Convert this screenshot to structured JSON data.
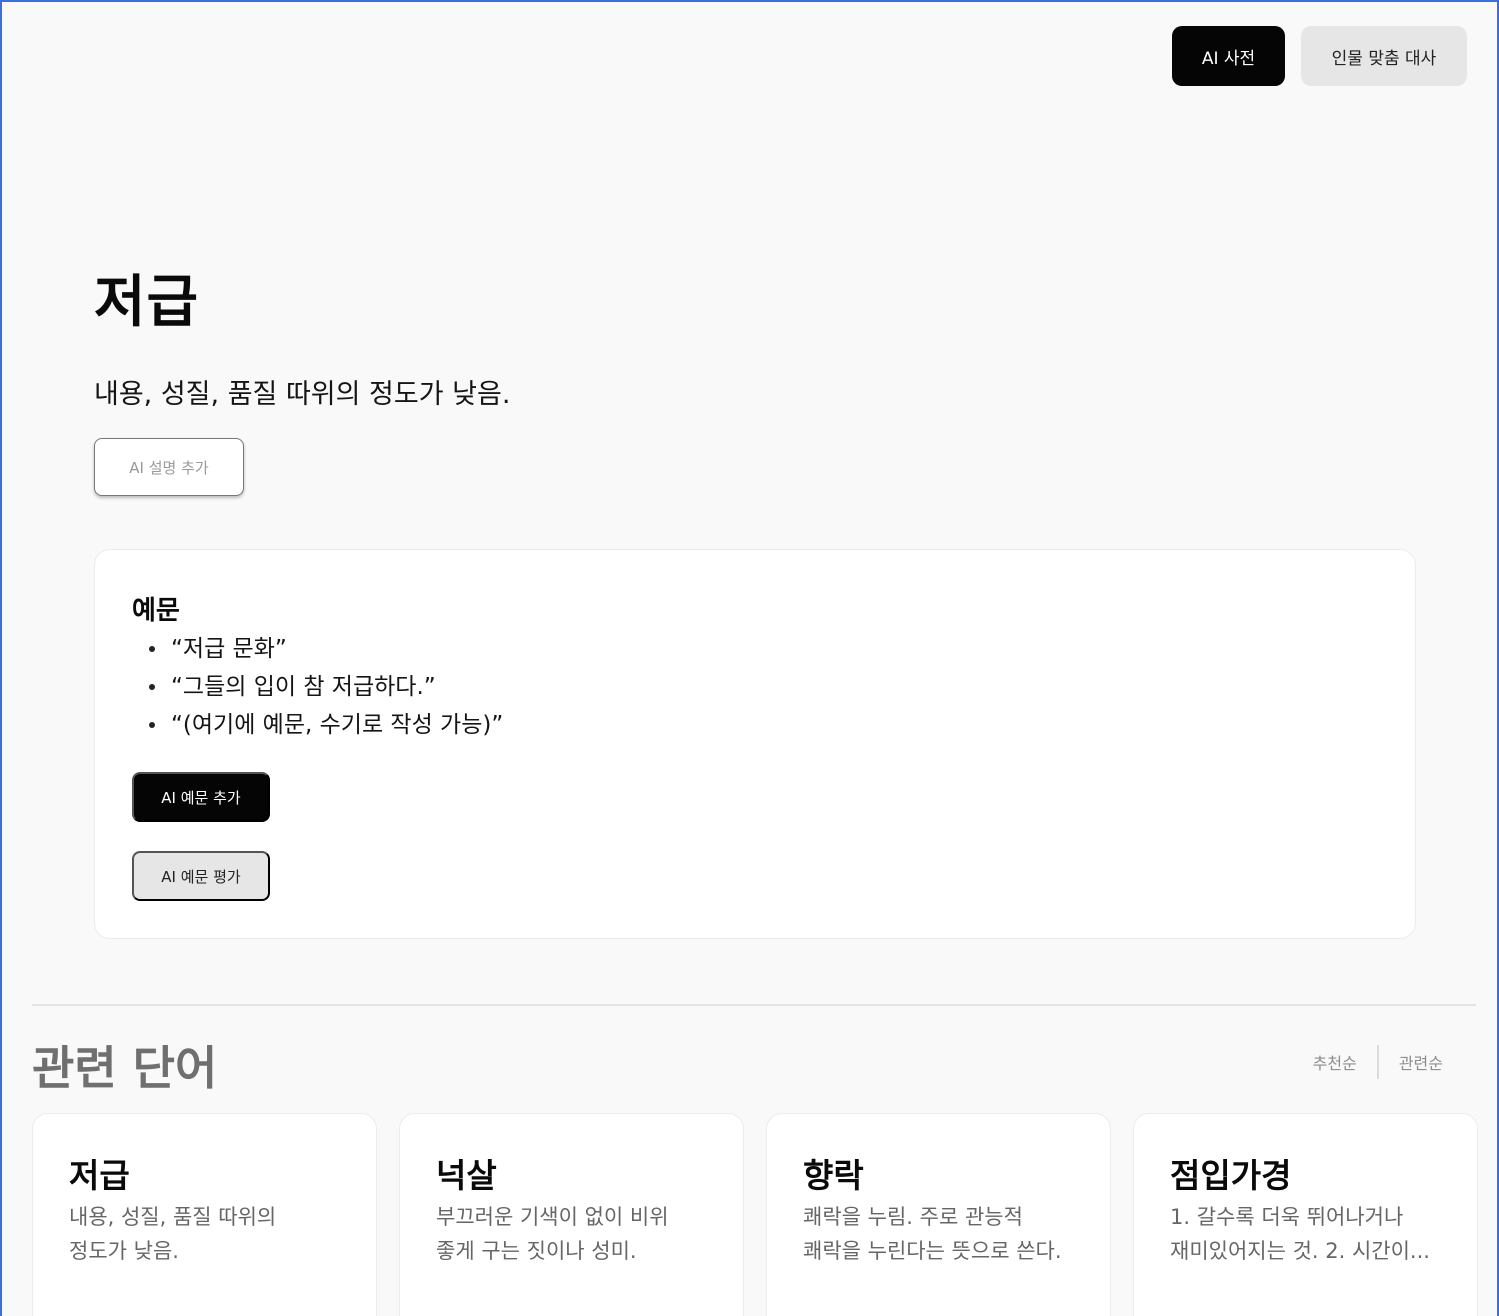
{
  "nav": {
    "ai_dictionary_label": "AI 사전",
    "character_dialogue_label": "인물 맞춤 대사"
  },
  "word": {
    "title": "저급",
    "definition": "내용, 성질, 품질 따위의 정도가 낮음.",
    "ai_explain_label": "AI 설명 추가"
  },
  "examples": {
    "heading": "예문",
    "items": [
      "“저급 문화”",
      "“그들의 입이 참 저급하다.”",
      "“(여기에 예문, 수기로 작성 가능)”"
    ],
    "add_button_label": "AI 예문 추가",
    "evaluate_button_label": "AI 예문 평가"
  },
  "related": {
    "heading": "관련 단어",
    "sort_recommended": "추천순",
    "sort_relevance": "관련순",
    "cards": [
      {
        "title": "저급",
        "desc": "내용, 성질, 품질 따위의 정도가 낮음."
      },
      {
        "title": "넉살",
        "desc": "부끄러운 기색이 없이 비위 좋게 구는 짓이나 성미."
      },
      {
        "title": "향락",
        "desc": "쾌락을 누림. 주로 관능적 쾌락을 누린다는 뜻으로 쓴다."
      },
      {
        "title": "점입가경",
        "desc": "1. 갈수록 더욱 뛰어나거나 재미있어지는 것. 2. 시간이..."
      }
    ]
  },
  "colors": {
    "frame_border": "#3a6fe0",
    "primary_button": "#050505",
    "secondary_button": "#e6e6e6",
    "background": "#f9f9f9"
  }
}
